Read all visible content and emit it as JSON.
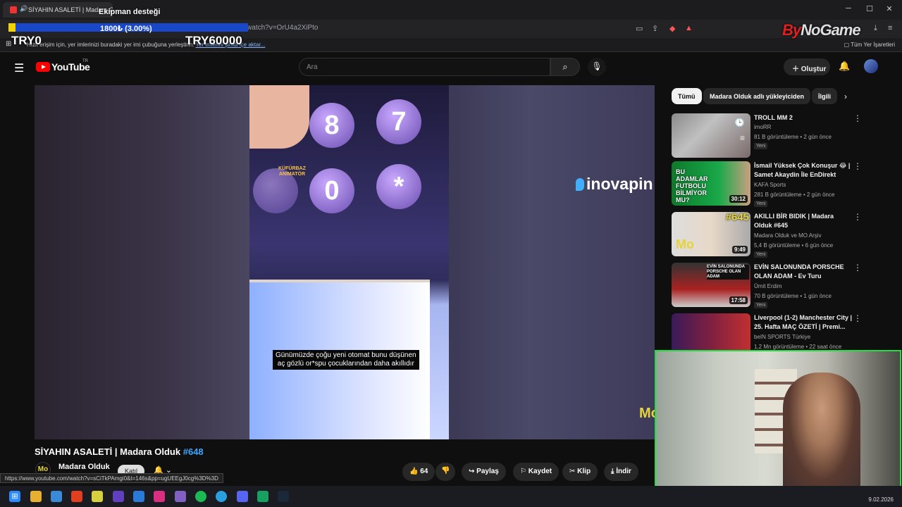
{
  "browser": {
    "tab_title": "SİYAHIN ASALETİ | Madara Ol...",
    "url": "youtube.com/watch?v=OrU4a2XiPto",
    "bookmarks_text": "Hızlı erişim için, yer imlerinizi buradaki yer imi çubuğuna yerleştirin.",
    "bookmarks_link": "Yer imlerini şimdi içe aktar...",
    "all_bookmarks": "Tüm Yer İşaretleri"
  },
  "overlay": {
    "donation_title": "Ekipman desteği",
    "donation_amount": "1800₺ (3.00%)",
    "donation_progress": 0.03,
    "min_label": "TRY0",
    "max_label": "TRY60000",
    "brand_prefix": "By",
    "brand_rest": "NoGame"
  },
  "youtube": {
    "logo": "YouTube",
    "region": "TR",
    "search_placeholder": "Ara",
    "create_label": "Oluştur"
  },
  "video": {
    "sponsor": "inovapin",
    "animator_line1": "KÜFÜRBAZ",
    "animator_line2": "ANİMATÖR",
    "subtitle_line1": "Günümüzde çoğu yeni otomat bunu düşünen",
    "subtitle_line2": "aç gözlü or*spu çocuklarından daha akıllıdır",
    "watermark": "Mo",
    "title": "SİYAHIN ASALETİ | Madara Olduk",
    "title_tag": "#648",
    "channel": "Madara Olduk",
    "join_label": "Katıl",
    "likes": "64",
    "share": "Paylaş",
    "save": "Kaydet",
    "clip": "Klip",
    "download": "İndir"
  },
  "status_url": "https://www.youtube.com/watch?v=sCiTkPAmgi0&t=146s&pp=ugUEEgJ0cg%3D%3D",
  "chips": [
    "Tümü",
    "Madara Olduk adlı yükleyiciden",
    "İlgili"
  ],
  "recommendations": [
    {
      "title": "TROLL MM 2",
      "channel": "imoRR",
      "meta": "81 B görüntüleme • 2 gün önce",
      "badge": "Yeni",
      "duration": ""
    },
    {
      "title": "İsmail Yüksek Çok Konuşur 😂 | Samet Akaydin İle EnDirekt",
      "channel": "KAFA Sports",
      "meta": "281 B görüntüleme • 2 gün önce",
      "badge": "Yeni",
      "duration": "30:12",
      "thumb_text": "BU ADAMLAR FUTBOLU BİLMİYOR MU?"
    },
    {
      "title": "AKILLI BİR BIDIK | Madara Olduk #645",
      "channel": "Madara Olduk ve MO Arşiv",
      "meta": "5,4 B görüntüleme • 6 gün önce",
      "badge": "Yeni",
      "duration": "9:49",
      "thumb_text": "#645"
    },
    {
      "title": "EVİN SALONUNDA PORSCHE OLAN ADAM - Ev Turu",
      "channel": "Ümit Erdim",
      "meta": "70 B görüntüleme • 1 gün önce",
      "badge": "Yeni",
      "duration": "17:58",
      "thumb_text": "EVİN SALONUNDA PORSCHE OLAN ADAM"
    },
    {
      "title": "Liverpool (1-2) Manchester City | 25. Hafta MAÇ ÖZETİ | Premi...",
      "channel": "beIN SPORTS Türkiye",
      "meta": "1,2 Mn görüntüleme • 22 saat önce",
      "badge": "",
      "duration": ""
    }
  ],
  "taskbar": {
    "date": "9.02.2026"
  }
}
